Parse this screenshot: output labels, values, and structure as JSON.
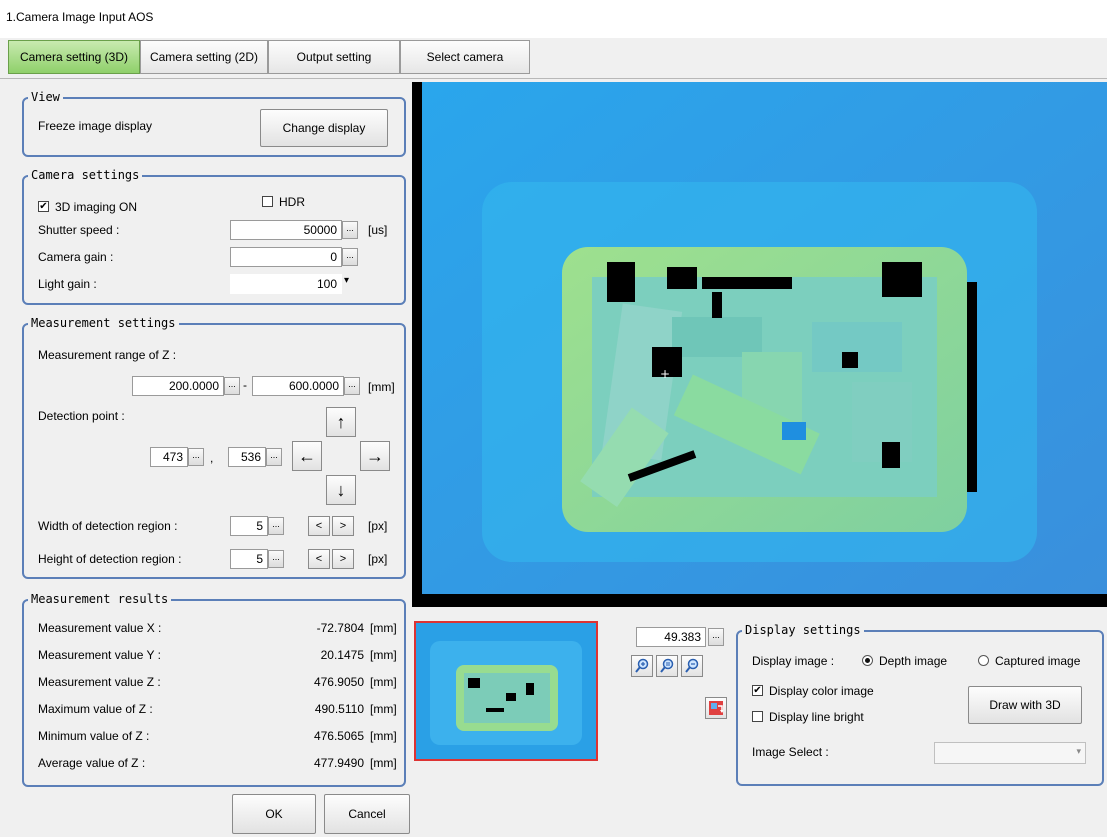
{
  "window": {
    "title": "1.Camera Image Input AOS"
  },
  "tabs": [
    {
      "label": "Camera setting (3D)"
    },
    {
      "label": "Camera setting (2D)"
    },
    {
      "label": "Output setting"
    },
    {
      "label": "Select camera"
    }
  ],
  "view": {
    "group_label": "View",
    "freeze_label": "Freeze image display",
    "change_display_button": "Change display"
  },
  "camera_settings": {
    "group_label": "Camera settings",
    "imaging_label": "3D imaging ON",
    "imaging_checked": "✔",
    "hdr_label": "HDR",
    "shutter_label": "Shutter speed :",
    "shutter_value": "50000",
    "shutter_unit": "[us]",
    "gain_label": "Camera gain :",
    "gain_value": "0",
    "light_label": "Light gain :",
    "light_value": "100",
    "dots": "..."
  },
  "measurement_settings": {
    "group_label": "Measurement settings",
    "range_label": "Measurement range of Z :",
    "range_min": "200.0000",
    "range_sep": "-",
    "range_max": "600.0000",
    "range_unit": "[mm]",
    "detection_label": "Detection point :",
    "point_x": "473",
    "point_sep": ",",
    "point_y": "536",
    "arrow_up": "↑",
    "arrow_left": "←",
    "arrow_right": "→",
    "arrow_down": "↓",
    "width_label": "Width of detection region :",
    "width_value": "5",
    "height_label": "Height of detection region :",
    "height_value": "5",
    "dec": "<",
    "inc": ">",
    "px_unit": "[px]"
  },
  "measurement_results": {
    "group_label": "Measurement results",
    "unit": "[mm]",
    "rows": [
      {
        "label": "Measurement value X :",
        "value": "-72.7804"
      },
      {
        "label": "Measurement value Y :",
        "value": "20.1475"
      },
      {
        "label": "Measurement value Z :",
        "value": "476.9050"
      },
      {
        "label": "Maximum value of Z :",
        "value": "490.5110"
      },
      {
        "label": "Minimum value of Z :",
        "value": "476.5065"
      },
      {
        "label": "Average value of Z :",
        "value": "477.9490"
      }
    ]
  },
  "footer": {
    "ok": "OK",
    "cancel": "Cancel"
  },
  "zoom": {
    "value": "49.383"
  },
  "display_settings": {
    "group_label": "Display settings",
    "image_label": "Display image :",
    "depth_label": "Depth image",
    "captured_label": "Captured image",
    "color_label": "Display color image",
    "color_checked": "✔",
    "line_label": "Display line bright",
    "draw_button": "Draw with 3D",
    "select_label": "Image Select :"
  },
  "colors": {
    "depth_bg": "#2e9be4",
    "tray": "#8fd88a",
    "group_border": "#5b7fb8",
    "active_tab": "#a0dc7c"
  }
}
